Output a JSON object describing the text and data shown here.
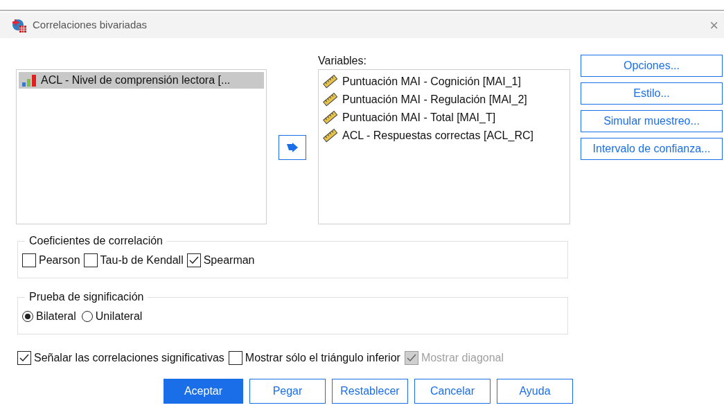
{
  "window": {
    "title": "Correlaciones bivariadas",
    "close": "×"
  },
  "source_list": {
    "items": [
      {
        "label": "ACL - Nivel de comprensión lectora [...",
        "selected": true
      }
    ]
  },
  "variables": {
    "label": "Variables:",
    "items": [
      {
        "label": "Puntuación MAI - Cognición [MAI_1]"
      },
      {
        "label": "Puntuación MAI - Regulación [MAI_2]"
      },
      {
        "label": "Puntuación MAI - Total [MAI_T]"
      },
      {
        "label": "ACL - Respuestas correctas [ACL_RC]"
      }
    ]
  },
  "side_buttons": [
    "Opciones...",
    "Estilo...",
    "Simular muestreo...",
    "Intervalo de confianza..."
  ],
  "coefficients": {
    "title": "Coeficientes de correlación",
    "options": [
      {
        "label": "Pearson",
        "checked": false
      },
      {
        "label": "Tau-b de Kendall",
        "checked": false
      },
      {
        "label": "Spearman",
        "checked": true
      }
    ]
  },
  "significance": {
    "title": "Prueba de significación",
    "options": [
      {
        "label": "Bilateral",
        "selected": true
      },
      {
        "label": "Unilateral",
        "selected": false
      }
    ]
  },
  "extra_options": [
    {
      "label": "Señalar las correlaciones significativas",
      "checked": true,
      "disabled": false
    },
    {
      "label": "Mostrar sólo el triángulo inferior",
      "checked": false,
      "disabled": false
    },
    {
      "label": "Mostrar diagonal",
      "checked": true,
      "disabled": true
    }
  ],
  "buttons": [
    {
      "label": "Aceptar",
      "default": true
    },
    {
      "label": "Pegar",
      "default": false
    },
    {
      "label": "Restablecer",
      "default": false
    },
    {
      "label": "Cancelar",
      "default": false
    },
    {
      "label": "Ayuda",
      "default": false
    }
  ]
}
